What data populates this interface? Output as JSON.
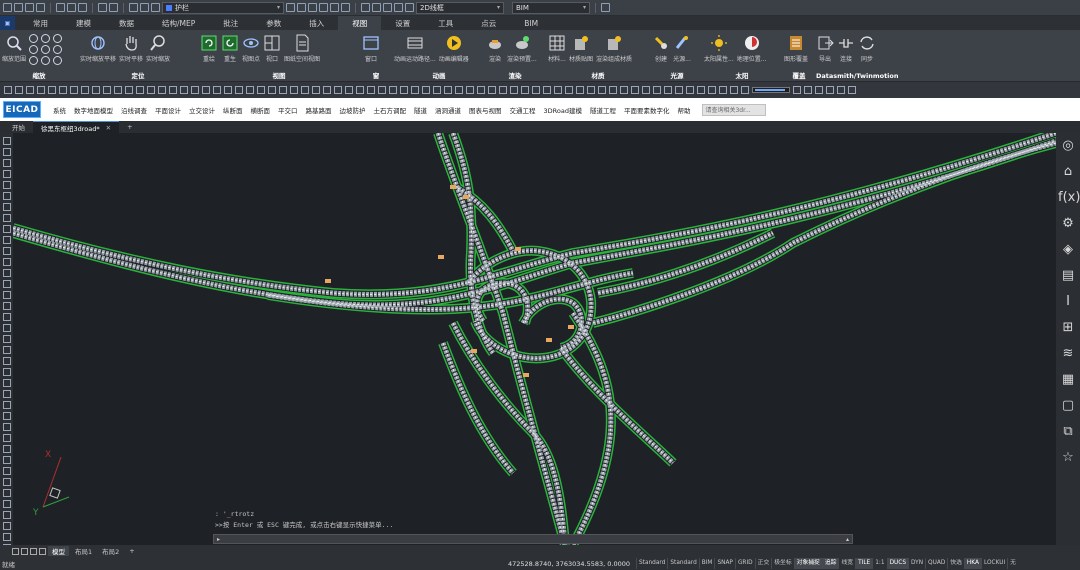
{
  "quick_access": {
    "layer_name": "护栏",
    "visual_style": "2D线框",
    "workspace": "BIM"
  },
  "ribbon_tabs": [
    "常用",
    "建模",
    "数据",
    "结构/MEP",
    "批注",
    "参数",
    "插入",
    "视图",
    "设置",
    "工具",
    "点云",
    "BIM"
  ],
  "active_tab": "视图",
  "ribbon_groups": [
    {
      "name": "缩放",
      "buttons": [
        "缩放范围"
      ]
    },
    {
      "name": "定位",
      "buttons": [
        "实时缩放平移",
        "实时平移",
        "实时缩放"
      ]
    },
    {
      "name": "视图",
      "buttons": [
        "重绘",
        "重生",
        "视图点",
        "视口",
        "图纸空间视图"
      ]
    },
    {
      "name": "窗",
      "buttons": [
        "窗口"
      ]
    },
    {
      "name": "动画",
      "buttons": [
        "动画运动路径...",
        "动画编辑器"
      ]
    },
    {
      "name": "渲染",
      "buttons": [
        "渲染",
        "渲染预置..."
      ]
    },
    {
      "name": "材质",
      "buttons": [
        "材料...",
        "材质贴图",
        "渲染组成材质"
      ]
    },
    {
      "name": "光源",
      "buttons": [
        "创建",
        "光源..."
      ]
    },
    {
      "name": "太阳",
      "buttons": [
        "太阳属性...",
        "地理位置..."
      ]
    },
    {
      "name": "覆盖",
      "buttons": [
        "图形覆盖"
      ]
    },
    {
      "name": "Datasmith/Twinmotion",
      "buttons": [
        "导出",
        "连接",
        "同步"
      ]
    }
  ],
  "eicad": {
    "logo": "EICAD",
    "menus": [
      "系统",
      "数字地面模型",
      "沿线调查",
      "平面设计",
      "立交设计",
      "纵断面",
      "横断面",
      "平交口",
      "路基路面",
      "边坡防护",
      "土石方调配",
      "隧道",
      "涵洞通道",
      "图表与视图",
      "交通工程",
      "3DRoad建模",
      "隧道工程",
      "平面要素数字化",
      "帮助"
    ],
    "search": "请查询相关3dr..."
  },
  "doc_tabs": [
    "开始",
    "徐黑东枢纽3droad*"
  ],
  "right_palette": [
    "◎",
    "⌂",
    "f(x)",
    "⚙",
    "◈",
    "▤",
    "I",
    "⊞",
    "≋",
    "▦",
    "▢",
    "⧉",
    "☆"
  ],
  "command_history": [
    ": '_rtrotz",
    ">>按 Enter 或 ESC 键完成, 或点击右键显示快捷菜单..."
  ],
  "layouts": [
    "模型",
    "布局1",
    "布局2"
  ],
  "active_layout": "模型",
  "status": {
    "left": "就绪",
    "coords": "472528.8740, 3763034.5583, 0.0000",
    "toggles": [
      "Standard",
      "Standard",
      "BIM",
      "SNAP",
      "GRID",
      "正交",
      "极坐标",
      "对象捕捉",
      "追踪",
      "线宽",
      "TILE",
      "1:1",
      "DUCS",
      "DYN",
      "QUAD",
      "快选",
      "HKA",
      "LOCKUI",
      "无"
    ]
  },
  "ucs": {
    "x_label": "X",
    "y_label": "Y"
  },
  "colors": {
    "road_edge": "#29b33a",
    "road_surface": "#9aa2aa",
    "accent": "#4a90e2"
  }
}
